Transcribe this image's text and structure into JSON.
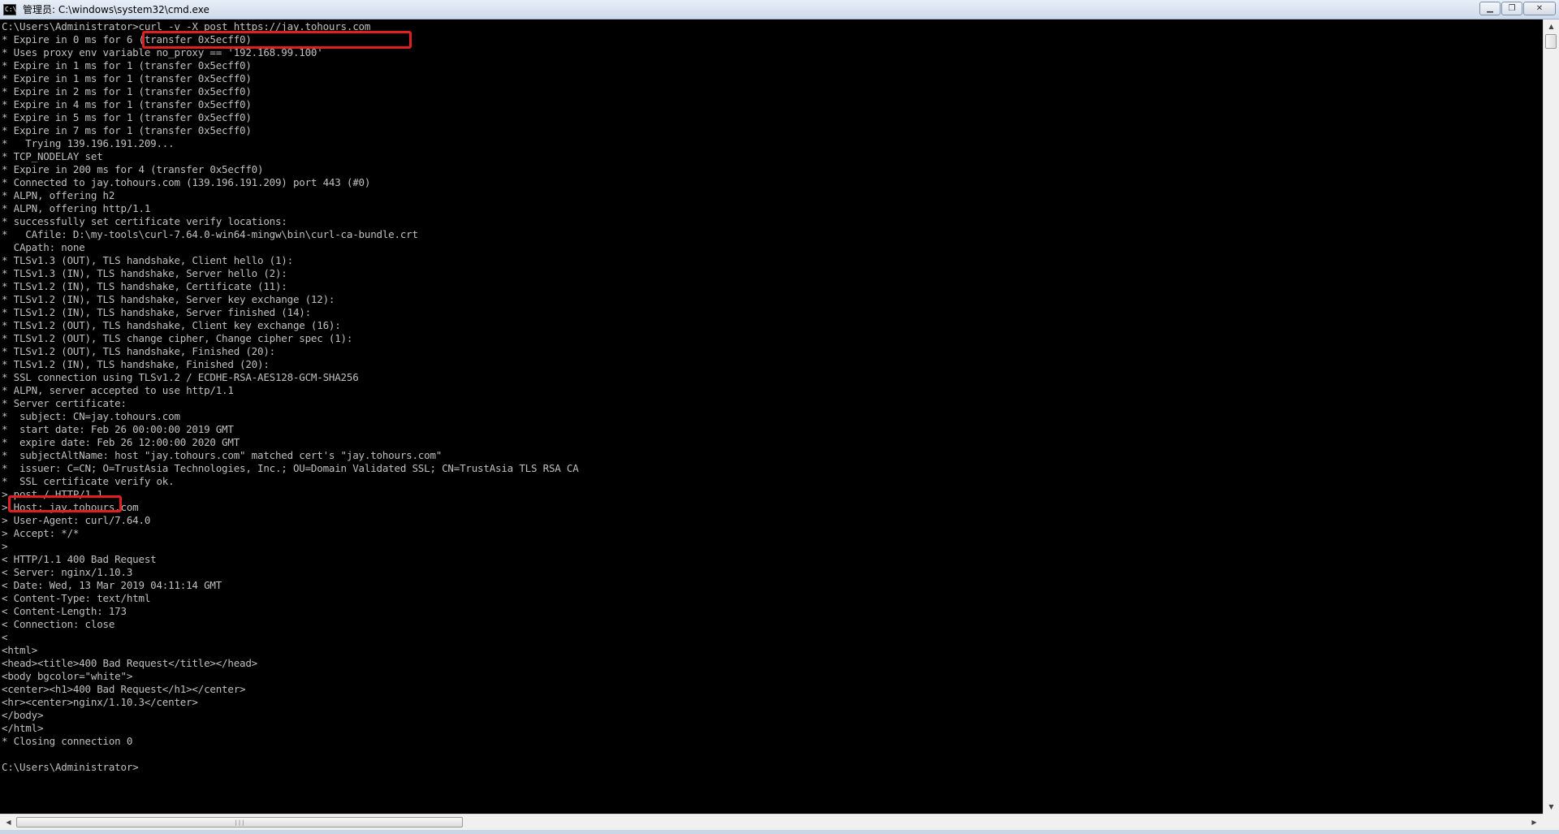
{
  "window": {
    "title": "管理员: C:\\windows\\system32\\cmd.exe",
    "icon": "cmd-icon",
    "buttons": {
      "minimize": "minimize-icon",
      "restore": "restore-icon",
      "close": "close-icon"
    }
  },
  "colors": {
    "console_bg": "#000000",
    "console_text": "#c0c0c0",
    "highlight": "#e02020"
  },
  "console": {
    "lines": [
      "C:\\Users\\Administrator>curl -v -X post https://jay.tohours.com",
      "* Expire in 0 ms for 6 (transfer 0x5ecff0)",
      "* Uses proxy env variable no_proxy == '192.168.99.100'",
      "* Expire in 1 ms for 1 (transfer 0x5ecff0)",
      "* Expire in 1 ms for 1 (transfer 0x5ecff0)",
      "* Expire in 2 ms for 1 (transfer 0x5ecff0)",
      "* Expire in 4 ms for 1 (transfer 0x5ecff0)",
      "* Expire in 5 ms for 1 (transfer 0x5ecff0)",
      "* Expire in 7 ms for 1 (transfer 0x5ecff0)",
      "*   Trying 139.196.191.209...",
      "* TCP_NODELAY set",
      "* Expire in 200 ms for 4 (transfer 0x5ecff0)",
      "* Connected to jay.tohours.com (139.196.191.209) port 443 (#0)",
      "* ALPN, offering h2",
      "* ALPN, offering http/1.1",
      "* successfully set certificate verify locations:",
      "*   CAfile: D:\\my-tools\\curl-7.64.0-win64-mingw\\bin\\curl-ca-bundle.crt",
      "  CApath: none",
      "* TLSv1.3 (OUT), TLS handshake, Client hello (1):",
      "* TLSv1.3 (IN), TLS handshake, Server hello (2):",
      "* TLSv1.2 (IN), TLS handshake, Certificate (11):",
      "* TLSv1.2 (IN), TLS handshake, Server key exchange (12):",
      "* TLSv1.2 (IN), TLS handshake, Server finished (14):",
      "* TLSv1.2 (OUT), TLS handshake, Client key exchange (16):",
      "* TLSv1.2 (OUT), TLS change cipher, Change cipher spec (1):",
      "* TLSv1.2 (OUT), TLS handshake, Finished (20):",
      "* TLSv1.2 (IN), TLS handshake, Finished (20):",
      "* SSL connection using TLSv1.2 / ECDHE-RSA-AES128-GCM-SHA256",
      "* ALPN, server accepted to use http/1.1",
      "* Server certificate:",
      "*  subject: CN=jay.tohours.com",
      "*  start date: Feb 26 00:00:00 2019 GMT",
      "*  expire date: Feb 26 12:00:00 2020 GMT",
      "*  subjectAltName: host \"jay.tohours.com\" matched cert's \"jay.tohours.com\"",
      "*  issuer: C=CN; O=TrustAsia Technologies, Inc.; OU=Domain Validated SSL; CN=TrustAsia TLS RSA CA",
      "*  SSL certificate verify ok.",
      "> post / HTTP/1.1",
      "> Host: jay.tohours.com",
      "> User-Agent: curl/7.64.0",
      "> Accept: */*",
      ">",
      "< HTTP/1.1 400 Bad Request",
      "< Server: nginx/1.10.3",
      "< Date: Wed, 13 Mar 2019 04:11:14 GMT",
      "< Content-Type: text/html",
      "< Content-Length: 173",
      "< Connection: close",
      "<",
      "<html>",
      "<head><title>400 Bad Request</title></head>",
      "<body bgcolor=\"white\">",
      "<center><h1>400 Bad Request</h1></center>",
      "<hr><center>nginx/1.10.3</center>",
      "</body>",
      "</html>",
      "* Closing connection 0",
      "",
      "C:\\Users\\Administrator>"
    ]
  },
  "scrollbars": {
    "vertical": {
      "up": "scroll-up-arrow-icon",
      "down": "scroll-down-arrow-icon"
    },
    "horizontal": {
      "left": "scroll-left-arrow-icon",
      "right": "scroll-right-arrow-icon",
      "grip": "|||"
    }
  }
}
